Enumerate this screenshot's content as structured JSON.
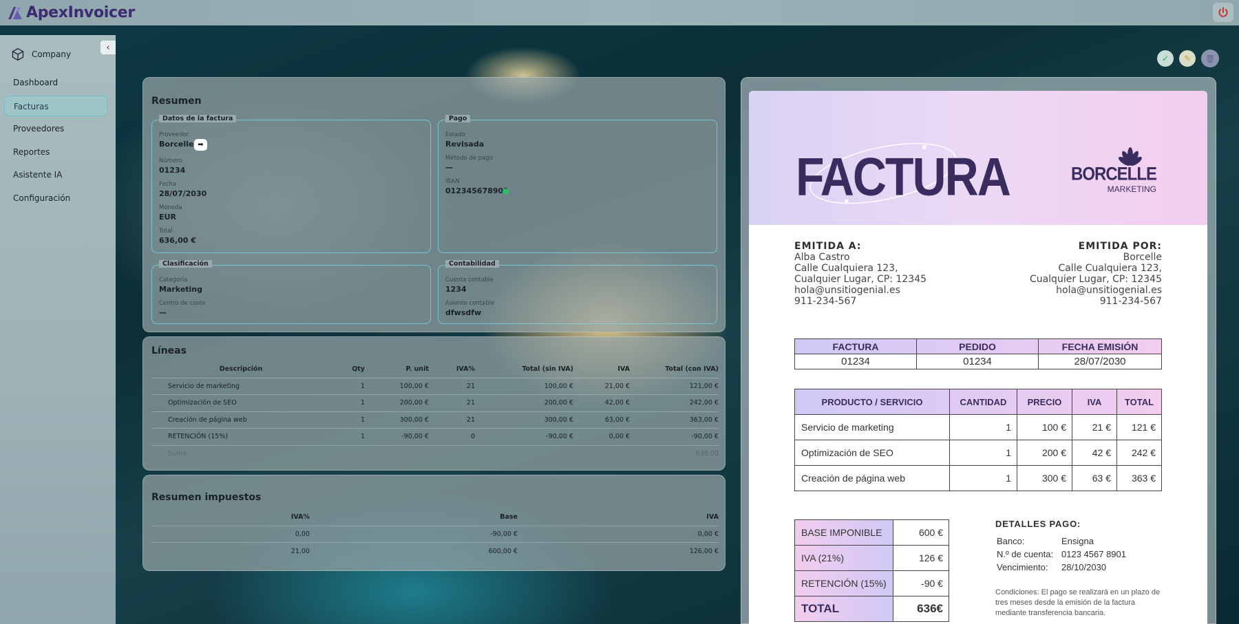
{
  "app": {
    "brand": "ApexInvoicer",
    "power_icon": "power-icon",
    "logo_icon": "apex-logo-icon"
  },
  "sidebar": {
    "company_label": "Company",
    "collapse_symbol": "‹",
    "items": [
      {
        "label": "Dashboard",
        "active": false
      },
      {
        "label": "Facturas",
        "active": true
      },
      {
        "label": "Proveedores",
        "active": false
      },
      {
        "label": "Reportes",
        "active": false
      },
      {
        "label": "Asistente IA",
        "active": false
      },
      {
        "label": "Configuración",
        "active": false
      }
    ]
  },
  "actions": {
    "approve_symbol": "✓",
    "edit_symbol": "✎",
    "delete_symbol": "🗑"
  },
  "resumen": {
    "title": "Resumen",
    "datos": {
      "legend": "Datos de la factura",
      "proveedor_label": "Proveedor",
      "proveedor": "Borcelle",
      "numero_label": "Número",
      "numero": "01234",
      "fecha_label": "Fecha",
      "fecha": "28/07/2030",
      "moneda_label": "Moneda",
      "moneda": "EUR",
      "total_label": "Total",
      "total": "636,00 €"
    },
    "pago": {
      "legend": "Pago",
      "estado_label": "Estado",
      "estado": "Revisada",
      "metodo_label": "Método de pago",
      "metodo": "—",
      "iban_label": "IBAN",
      "iban": "012345678901"
    },
    "clasificacion": {
      "legend": "Clasificación",
      "categoria_label": "Categoría",
      "categoria": "Marketing",
      "centro_label": "Centro de coste",
      "centro": "—"
    },
    "contabilidad": {
      "legend": "Contabilidad",
      "cuenta_label": "Cuenta contable",
      "cuenta": "1234",
      "asiento_label": "Asiento contable",
      "asiento": "dfwsdfw"
    }
  },
  "lineas": {
    "title": "Líneas",
    "headers": [
      "Descripción",
      "Qty",
      "P. unit",
      "IVA%",
      "Total (sin IVA)",
      "IVA",
      "Total (con IVA)"
    ],
    "rows": [
      [
        "Servicio de marketing",
        "1",
        "100,00 €",
        "21",
        "100,00 €",
        "21,00 €",
        "121,00 €"
      ],
      [
        "Optimización de SEO",
        "1",
        "200,00 €",
        "21",
        "200,00 €",
        "42,00 €",
        "242,00 €"
      ],
      [
        "Creación de página web",
        "1",
        "300,00 €",
        "21",
        "300,00 €",
        "63,00 €",
        "363,00 €"
      ],
      [
        "RETENCIÓN (15%)",
        "1",
        "-90,00 €",
        "0",
        "-90,00 €",
        "0,00 €",
        "-90,00 €"
      ]
    ],
    "sum_label": "Suma",
    "sum_value": "636.00"
  },
  "impuestos": {
    "title": "Resumen impuestos",
    "headers": [
      "IVA%",
      "Base",
      "IVA"
    ],
    "rows": [
      [
        "0,00",
        "-90,00 €",
        "0,00 €"
      ],
      [
        "21,00",
        "600,00 €",
        "126,00 €"
      ]
    ]
  },
  "doc": {
    "title": "FACTURA",
    "brand_name": "BORCELLE",
    "brand_sub": "MARKETING",
    "emitida_a": {
      "heading": "EMITIDA A:",
      "lines": [
        "Alba Castro",
        "Calle Cualquiera 123,",
        "Cualquier Lugar, CP: 12345",
        "hola@unsitiogenial.es",
        "911-234-567"
      ]
    },
    "emitida_por": {
      "heading": "EMITIDA POR:",
      "lines": [
        "Borcelle",
        "Calle Cualquiera 123,",
        "Cualquier Lugar, CP: 12345",
        "hola@unsitiogenial.es",
        "911-234-567"
      ]
    },
    "meta_headers": [
      "FACTURA",
      "PEDIDO",
      "FECHA EMISIÓN"
    ],
    "meta_values": [
      "01234",
      "01234",
      "28/07/2030"
    ],
    "items_headers": [
      "PRODUCTO / SERVICIO",
      "CANTIDAD",
      "PRECIO",
      "IVA",
      "TOTAL"
    ],
    "items": [
      [
        "Servicio de marketing",
        "1",
        "100 €",
        "21 €",
        "121 €"
      ],
      [
        "Optimización de SEO",
        "1",
        "200 €",
        "42 €",
        "242 €"
      ],
      [
        "Creación de página web",
        "1",
        "300 €",
        "63 €",
        "363 €"
      ]
    ],
    "totals": [
      [
        "BASE IMPONIBLE",
        "600 €"
      ],
      [
        "IVA (21%)",
        "126 €"
      ],
      [
        "RETENCIÓN (15%)",
        "-90 €"
      ],
      [
        "TOTAL",
        "636€"
      ]
    ],
    "pago": {
      "heading": "DETALLES PAGO:",
      "rows": [
        [
          "Banco:",
          "Ensigna"
        ],
        [
          "N.º de cuenta:",
          "0123 4567 8901"
        ],
        [
          "Vencimiento:",
          "28/10/2030"
        ]
      ],
      "condiciones": [
        "Condiciones: El pago se realizará en un plazo de",
        "tres meses desde la emisión de la factura",
        "mediante transferencia bancaria."
      ]
    }
  }
}
